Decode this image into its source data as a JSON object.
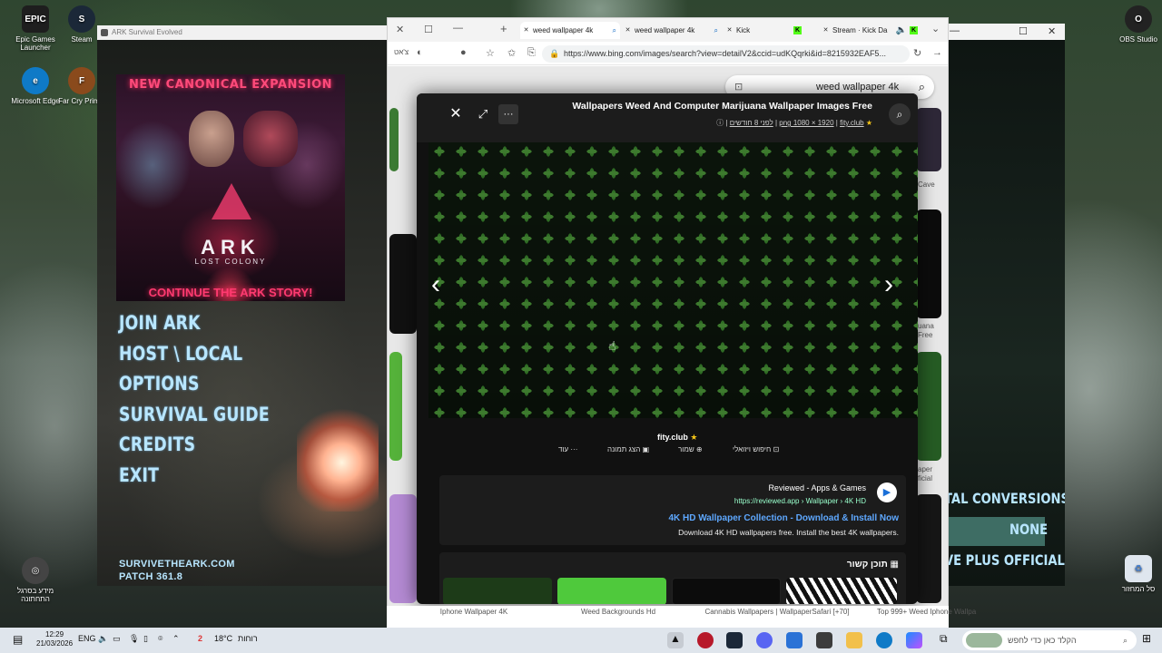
{
  "desktop": {
    "icons": [
      {
        "label": "Epic Games Launcher",
        "glyph": "EPIC",
        "color": "#1e1e1e"
      },
      {
        "label": "Steam",
        "glyph": "S",
        "color": "#1b2838"
      },
      {
        "label": "Microsoft Edge",
        "glyph": "e",
        "color": "#0f7ac7"
      },
      {
        "label": "Far Cry Primal",
        "glyph": "F",
        "color": "#8a4a1c"
      },
      {
        "label": "OBS Studio",
        "glyph": "O",
        "color": "#222"
      },
      {
        "label": "סל המחזור",
        "glyph": "♻",
        "color": "#ccd"
      },
      {
        "label": "מידע בסרגל התחתונה",
        "glyph": "◎",
        "color": "#444"
      }
    ]
  },
  "ark": {
    "window_title": "ARK Survival Evolved",
    "banner": {
      "top": "NEW CANONICAL EXPANSION",
      "logo": "ARK",
      "subtitle": "LOST COLONY",
      "bottom": "CONTINUE THE ARK STORY!"
    },
    "menu": [
      "JOIN ARK",
      "HOST \\ LOCAL",
      "OPTIONS",
      "SURVIVAL GUIDE",
      "CREDITS",
      "EXIT"
    ],
    "footer_site": "SURVIVETHEARK.COM",
    "footer_patch": "PATCH 361.8"
  },
  "bg_window": {
    "rows": [
      "TAL CONVERSIONS",
      "NONE",
      "VE PLUS OFFICIAL"
    ]
  },
  "browser": {
    "tabs": [
      {
        "label": "weed wallpaper 4k",
        "active": true
      },
      {
        "label": "weed wallpaper 4k",
        "active": false
      },
      {
        "label": "Kick",
        "active": false
      },
      {
        "label": "Stream · Kick Da",
        "active": false
      }
    ],
    "profile_label": "צ'אט",
    "url": "https://www.bing.com/images/search?view=detailV2&ccid=udKQqrki&id=8215932EAF5...",
    "search_query": "weed wallpaper 4k"
  },
  "viewer": {
    "title": "Wallpapers Weed And Computer Marijuana Wallpaper Images Free",
    "meta_source": "fity.club",
    "meta_size": "png 1080 × 1920",
    "meta_time": "לפני 8 חודשים",
    "image_source": "fity.club",
    "actions": [
      {
        "label": "חיפוש ויזואלי",
        "icon": "visual-search-icon"
      },
      {
        "label": "שמור",
        "icon": "save-icon"
      },
      {
        "label": "הצג תמונה",
        "icon": "image-icon"
      },
      {
        "label": "עוד",
        "icon": "more-icon"
      }
    ],
    "ad": {
      "site": "Reviewed - Apps & Games",
      "url": "https://reviewed.app › Wallpaper › 4K HD",
      "title": "4K HD Wallpaper Collection - Download & Install Now",
      "desc": "Download 4K HD wallpapers free. Install the best 4K wallpapers."
    },
    "related_label": "תוכן קשור"
  },
  "page_side_labels": [
    "Cave",
    "uana Free",
    "aper ficial"
  ],
  "captions": [
    "Iphone Wallpaper 4K",
    "Weed Backgrounds Hd",
    "Cannabis Wallpapers | WallpaperSafari [+70]",
    "Top 999+ Weed Iphone Wallpa"
  ],
  "taskbar": {
    "time": "12:29",
    "date": "21/03/2026",
    "lang": "ENG",
    "weather": "18°C",
    "weather_label": "רוחות",
    "notification_count": "2",
    "search_placeholder": "הקלד כאן כדי לחפש"
  },
  "colors": {
    "ark_menu": "#b8e6ff",
    "bing_link": "#5ea8ff",
    "ark_accent": "#ff3a70"
  }
}
